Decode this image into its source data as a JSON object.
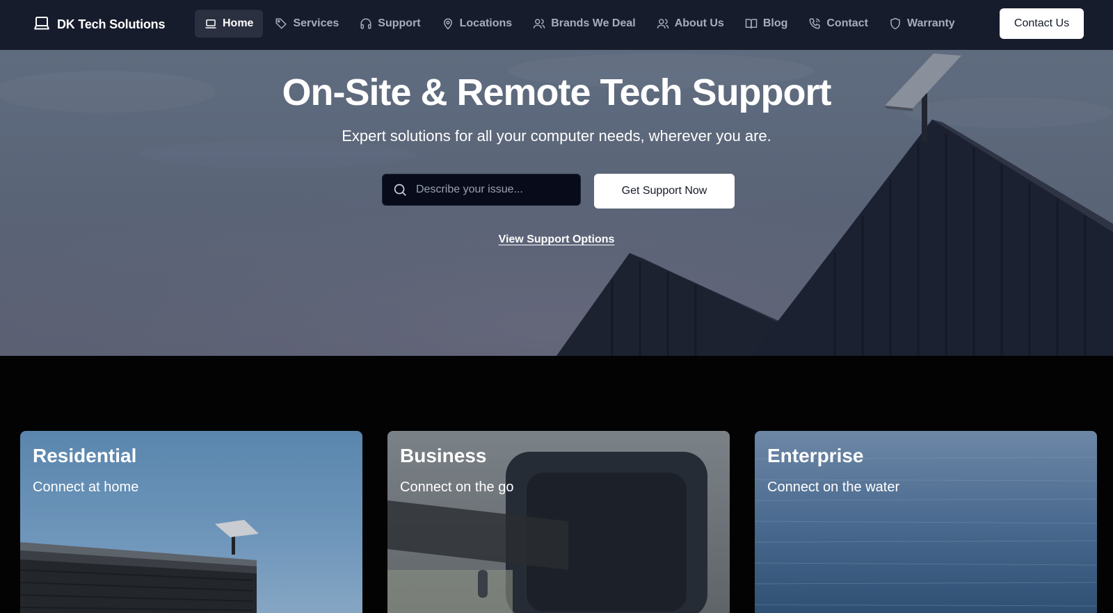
{
  "nav": {
    "brand": {
      "name": "DK Tech Solutions",
      "icon": "laptop-icon"
    },
    "links": [
      {
        "label": "Home",
        "icon": "laptop-icon",
        "active": true
      },
      {
        "label": "Services",
        "icon": "tag-icon"
      },
      {
        "label": "Support",
        "icon": "headphones-icon"
      },
      {
        "label": "Locations",
        "icon": "map-pin-icon"
      },
      {
        "label": "Brands We Deal",
        "icon": "users-icon"
      },
      {
        "label": "About Us",
        "icon": "users-icon"
      },
      {
        "label": "Blog",
        "icon": "book-icon"
      },
      {
        "label": "Contact",
        "icon": "phone-icon"
      },
      {
        "label": "Warranty",
        "icon": "shield-icon"
      }
    ],
    "cta": "Contact Us"
  },
  "hero": {
    "title": "On-Site & Remote Tech Support",
    "subtitle": "Expert solutions for all your computer needs, wherever you are.",
    "search": {
      "placeholder": "Describe your issue...",
      "value": "",
      "icon": "search-icon"
    },
    "primary_button": "Get Support Now",
    "secondary_link": "View Support Options"
  },
  "cards": [
    {
      "title": "Residential",
      "subtitle": "Connect at home"
    },
    {
      "title": "Business",
      "subtitle": "Connect on the go"
    },
    {
      "title": "Enterprise",
      "subtitle": "Connect on the water"
    }
  ],
  "colors": {
    "nav_bg": "#171c2c",
    "page_bg": "#030303",
    "button_bg": "#ffffff",
    "button_text": "#141a28",
    "search_bg": "#080c1a"
  }
}
